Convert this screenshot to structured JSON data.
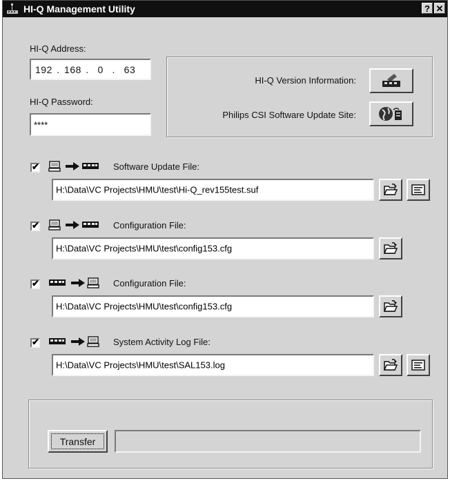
{
  "window": {
    "title": "HI-Q Management Utility",
    "help_glyph": "?",
    "close_glyph": "✕"
  },
  "address": {
    "label": "HI-Q Address:",
    "value": "192 . 168 .  0  .  63"
  },
  "password": {
    "label": "HI-Q Password:",
    "value": "****"
  },
  "info_panel": {
    "version_label": "HI-Q Version Information:",
    "update_site_label": "Philips CSI Software Update Site:",
    "version_icon": "device-info-icon",
    "update_site_icon": "globe-icon"
  },
  "transfers": [
    {
      "checked": true,
      "check_glyph": "✔",
      "direction": "pc-to-device",
      "label": "Software Update File:",
      "path": "H:\\Data\\VC Projects\\HMU\\test\\Hi-Q_rev155test.suf",
      "has_view_button": true,
      "view_icon": "view-file-icon"
    },
    {
      "checked": true,
      "check_glyph": "✔",
      "direction": "pc-to-device",
      "label": "Configuration File:",
      "path": "H:\\Data\\VC Projects\\HMU\\test\\config153.cfg",
      "has_view_button": false
    },
    {
      "checked": true,
      "check_glyph": "✔",
      "direction": "device-to-pc",
      "label": "Configuration File:",
      "path": "H:\\Data\\VC Projects\\HMU\\test\\config153.cfg",
      "has_view_button": false
    },
    {
      "checked": true,
      "check_glyph": "✔",
      "direction": "device-to-pc",
      "label": "System Activity Log File:",
      "path": "H:\\Data\\VC Projects\\HMU\\test\\SAL153.log",
      "has_view_button": true,
      "view_icon": "view-log-icon"
    }
  ],
  "transfer_button": {
    "label": "Transfer"
  },
  "progress": {
    "percent": 0
  }
}
